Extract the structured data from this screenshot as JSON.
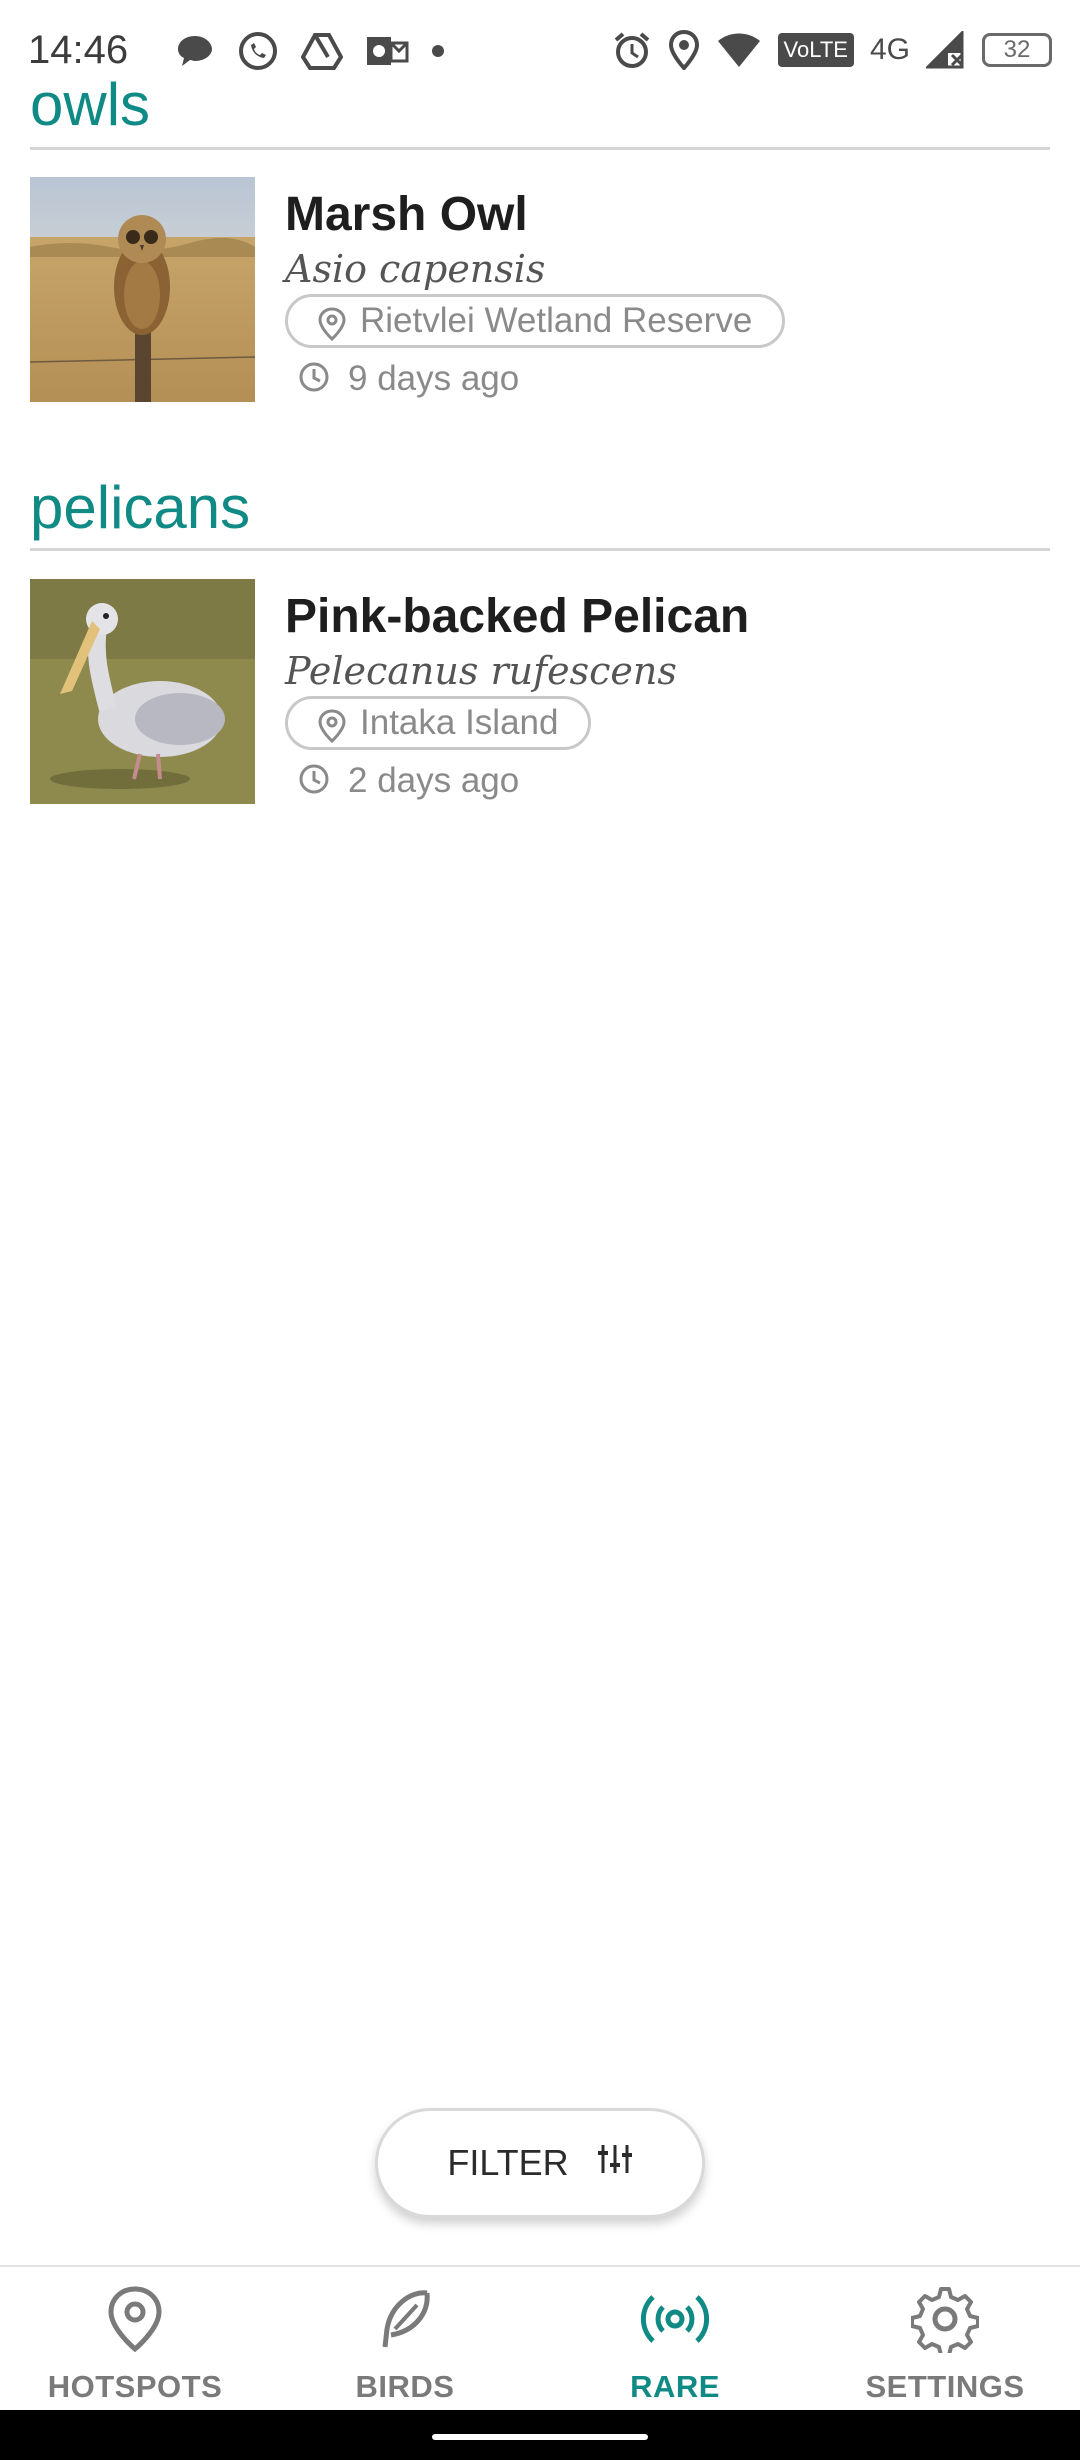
{
  "status_bar": {
    "time": "14:46",
    "volte": "VoLTE",
    "network": "4G",
    "battery": "32"
  },
  "sections": [
    {
      "title": "owls",
      "item": {
        "name": "Marsh Owl",
        "scientific": "Asio capensis",
        "location": "Rietvlei Wetland Reserve",
        "time": "9 days ago"
      }
    },
    {
      "title": "pelicans",
      "item": {
        "name": "Pink-backed Pelican",
        "scientific": "Pelecanus rufescens",
        "location": "Intaka Island",
        "time": "2 days ago"
      }
    }
  ],
  "filter": {
    "label": "FILTER"
  },
  "nav": {
    "active": "RARE",
    "accent": "#0f8a84",
    "items": [
      {
        "label": "HOTSPOTS",
        "icon": "map-pin-icon"
      },
      {
        "label": "BIRDS",
        "icon": "feather-icon"
      },
      {
        "label": "RARE",
        "icon": "broadcast-icon"
      },
      {
        "label": "SETTINGS",
        "icon": "gear-icon"
      }
    ]
  }
}
